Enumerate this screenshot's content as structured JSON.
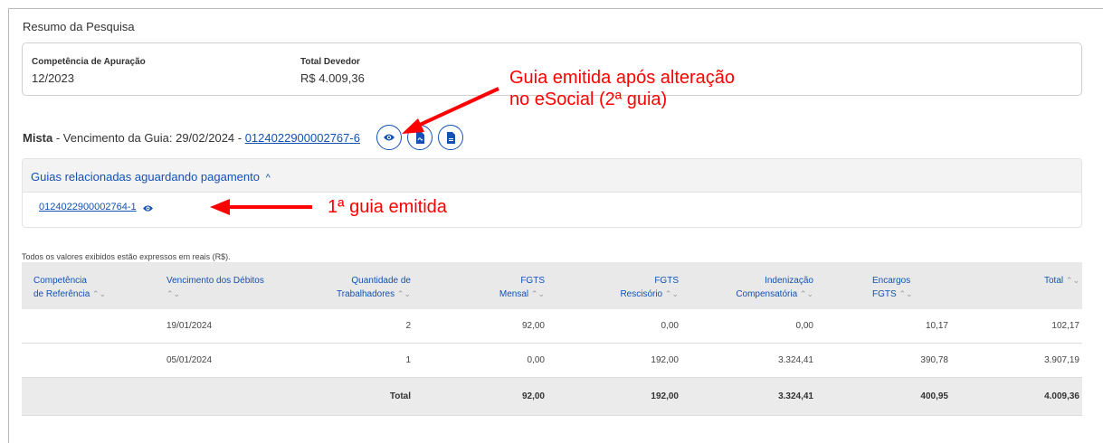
{
  "page": {
    "title": "Resumo da Pesquisa"
  },
  "summary": {
    "competencia_label": "Competência de Apuração",
    "competencia_value": "12/2023",
    "total_label": "Total Devedor",
    "total_value": "R$ 4.009,36"
  },
  "guide": {
    "type": "Mista",
    "text": " - Vencimento da Guia: 29/02/2024 - ",
    "number": "0124022900002767-6"
  },
  "related": {
    "title": "Guias relacionadas aguardando pagamento",
    "chevron": "^",
    "items": [
      "0124022900002764-1"
    ]
  },
  "note": "Todos os valores exibidos estão expressos em reais (R$).",
  "table": {
    "headers": [
      {
        "line1": "Competência",
        "line2": "de Referência"
      },
      {
        "line1": "Vencimento dos Débitos",
        "line2": ""
      },
      {
        "line1": "Quantidade de",
        "line2": "Trabalhadores"
      },
      {
        "line1": "FGTS",
        "line2": "Mensal"
      },
      {
        "line1": "FGTS",
        "line2": "Rescisório"
      },
      {
        "line1": "Indenização",
        "line2": "Compensatória"
      },
      {
        "line1": "Encargos",
        "line2": "FGTS"
      },
      {
        "line1": "Total",
        "line2": ""
      }
    ],
    "sort_symbol": "⌃⌄",
    "rows": [
      [
        "",
        "19/01/2024",
        "2",
        "92,00",
        "0,00",
        "0,00",
        "10,17",
        "102,17"
      ],
      [
        "",
        "05/01/2024",
        "1",
        "0,00",
        "192,00",
        "3.324,41",
        "390,78",
        "3.907,19"
      ]
    ],
    "total_row": [
      "",
      "",
      "Total",
      "92,00",
      "192,00",
      "3.324,41",
      "400,95",
      "4.009,36"
    ]
  },
  "annotations": {
    "second_guide_line1": "Guia emitida após alteração",
    "second_guide_line2": "no eSocial (2ª guia)",
    "first_guide": "1ª guia emitida",
    "color": "#ff0000"
  },
  "icons": {
    "view": "eye-icon",
    "pdf": "pdf-file-icon",
    "doc": "document-file-icon",
    "related_view": "eye-icon"
  },
  "colors": {
    "link": "#1351b4",
    "header_bg": "#e9e9e9",
    "annotation": "#ff0000"
  }
}
